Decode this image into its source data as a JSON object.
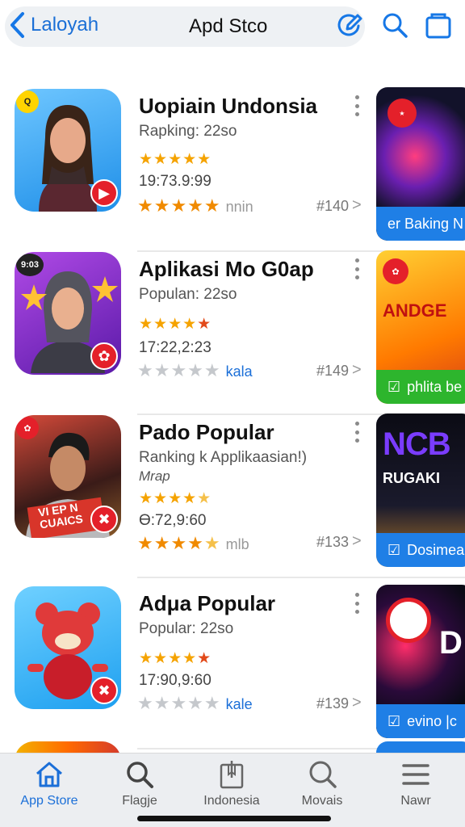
{
  "header": {
    "back_label": "Laloyah",
    "title": "Apd Stco"
  },
  "apps": [
    {
      "name": "Uopiain Undonsia",
      "sub1": "Rapking: 22so",
      "sub2": "",
      "rating_stars": 5,
      "date": "19:73.9:99",
      "rating2_stars": 5,
      "rating2_label": "nnin",
      "rank": "#140",
      "thumb_label": "er Baking N",
      "thumb_bar_color": "#1f7fe6"
    },
    {
      "name": "Aplikasi Mo G0ap",
      "sub1": "Populan: 22so",
      "sub2": "",
      "rating_stars": 4.5,
      "date": "17:22,2:23",
      "rating2_stars": 0,
      "rating2_label": "kala",
      "rank": "#149",
      "thumb_label": "phlita be",
      "thumb_bar_color": "#2db52d",
      "thumb_text": "ANDGE"
    },
    {
      "name": "Pado Popular",
      "sub1": "Ranking k Applikaasian!)",
      "sub2": "Mrap",
      "rating_stars": 4.5,
      "date": "Ɵ:72,9:60",
      "rating2_stars": 4.5,
      "rating2_label": "mlb",
      "rank": "#133",
      "thumb_label": "Dosimea",
      "thumb_bar_color": "#1f7fe6",
      "thumb_text": "NCB",
      "thumb_text2": "RUGAKI"
    },
    {
      "name": "Adμa Popular",
      "sub1": "Popular: 22so",
      "sub2": "",
      "rating_stars": 4.5,
      "date": "17:90,9:60",
      "rating2_stars": 0,
      "rating2_label": "kale",
      "rank": "#139",
      "thumb_label": "evino |c",
      "thumb_bar_color": "#1f7fe6",
      "thumb_text": "D"
    }
  ],
  "icon_badges": [
    "Q",
    "9:03",
    "",
    ""
  ],
  "icon_card_texts": [
    "",
    "",
    "VI EP N CUAICS",
    ""
  ],
  "tabs": [
    {
      "label": "App Store",
      "icon": "house-icon",
      "active": true
    },
    {
      "label": "Flagje",
      "icon": "search-icon",
      "active": false
    },
    {
      "label": "Indonesia",
      "icon": "bookmark-icon",
      "active": false
    },
    {
      "label": "Movais",
      "icon": "search-icon",
      "active": false
    },
    {
      "label": "Nawr",
      "icon": "menu-icon",
      "active": false
    }
  ],
  "colors": {
    "accent": "#1b6fd8",
    "star": "#f5a300"
  }
}
